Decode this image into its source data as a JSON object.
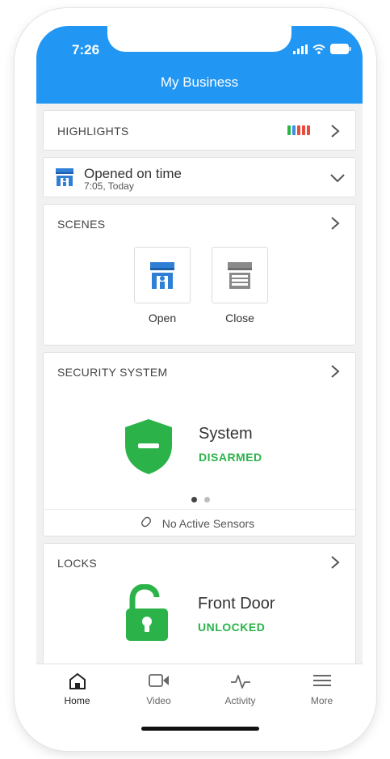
{
  "status_bar": {
    "time": "7:26"
  },
  "header": {
    "title": "My Business"
  },
  "highlights": {
    "title": "HIGHLIGHTS",
    "bar_colors": [
      "#2bb34a",
      "#3f8fe0",
      "#e84c3d",
      "#e84c3d",
      "#e84c3d"
    ]
  },
  "business_status": {
    "title": "Opened on time",
    "subtitle": "7:05, Today"
  },
  "scenes": {
    "title": "SCENES",
    "items": [
      {
        "label": "Open",
        "icon": "store-open-icon"
      },
      {
        "label": "Close",
        "icon": "store-closed-icon"
      }
    ]
  },
  "security": {
    "title": "SECURITY SYSTEM",
    "name": "System",
    "state": "DISARMED",
    "sensors": "No Active Sensors",
    "pager": {
      "count": 2,
      "active": 0
    }
  },
  "locks": {
    "title": "LOCKS",
    "name": "Front Door",
    "state": "UNLOCKED"
  },
  "tabs": [
    {
      "label": "Home",
      "icon": "home-icon",
      "active": true
    },
    {
      "label": "Video",
      "icon": "video-icon",
      "active": false
    },
    {
      "label": "Activity",
      "icon": "activity-icon",
      "active": false
    },
    {
      "label": "More",
      "icon": "menu-icon",
      "active": false
    }
  ],
  "colors": {
    "header": "#2196f3",
    "success": "#2bb34a",
    "store_blue": "#2f7fd6"
  }
}
